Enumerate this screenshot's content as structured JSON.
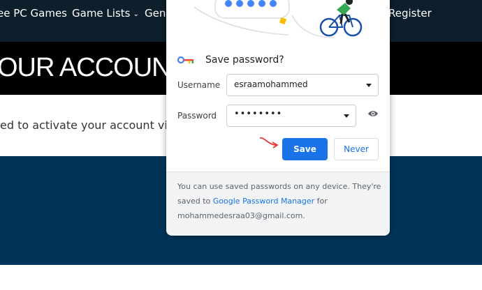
{
  "site": {
    "nav": {
      "free_pc_games": "ee PC Games",
      "game_lists": "Game Lists",
      "genre": "Genr",
      "register": "Register"
    },
    "hero_title": "OUR ACCOUNT",
    "notice": "ed to activate your account via t"
  },
  "popup": {
    "title": "Save password?",
    "username_label": "Username",
    "username_value": "esraamohammed",
    "password_label": "Password",
    "password_value": "••••••••",
    "save_label": "Save",
    "never_label": "Never",
    "footer_text_1": "You can use saved passwords on any device. They're saved to ",
    "footer_link": "Google Password Manager",
    "footer_text_2": " for mohammedesraa03@gmail.com."
  },
  "icons": {
    "key": "key-icon",
    "eye": "eye-icon",
    "caret": "caret-down-icon",
    "chevron": "chevron-down-icon",
    "arrow": "red-arrow-annotation"
  },
  "colors": {
    "accent": "#1a73e8",
    "nav_bg": "#0d1f2b",
    "band_bg": "#003559",
    "annotation": "#e53935"
  }
}
